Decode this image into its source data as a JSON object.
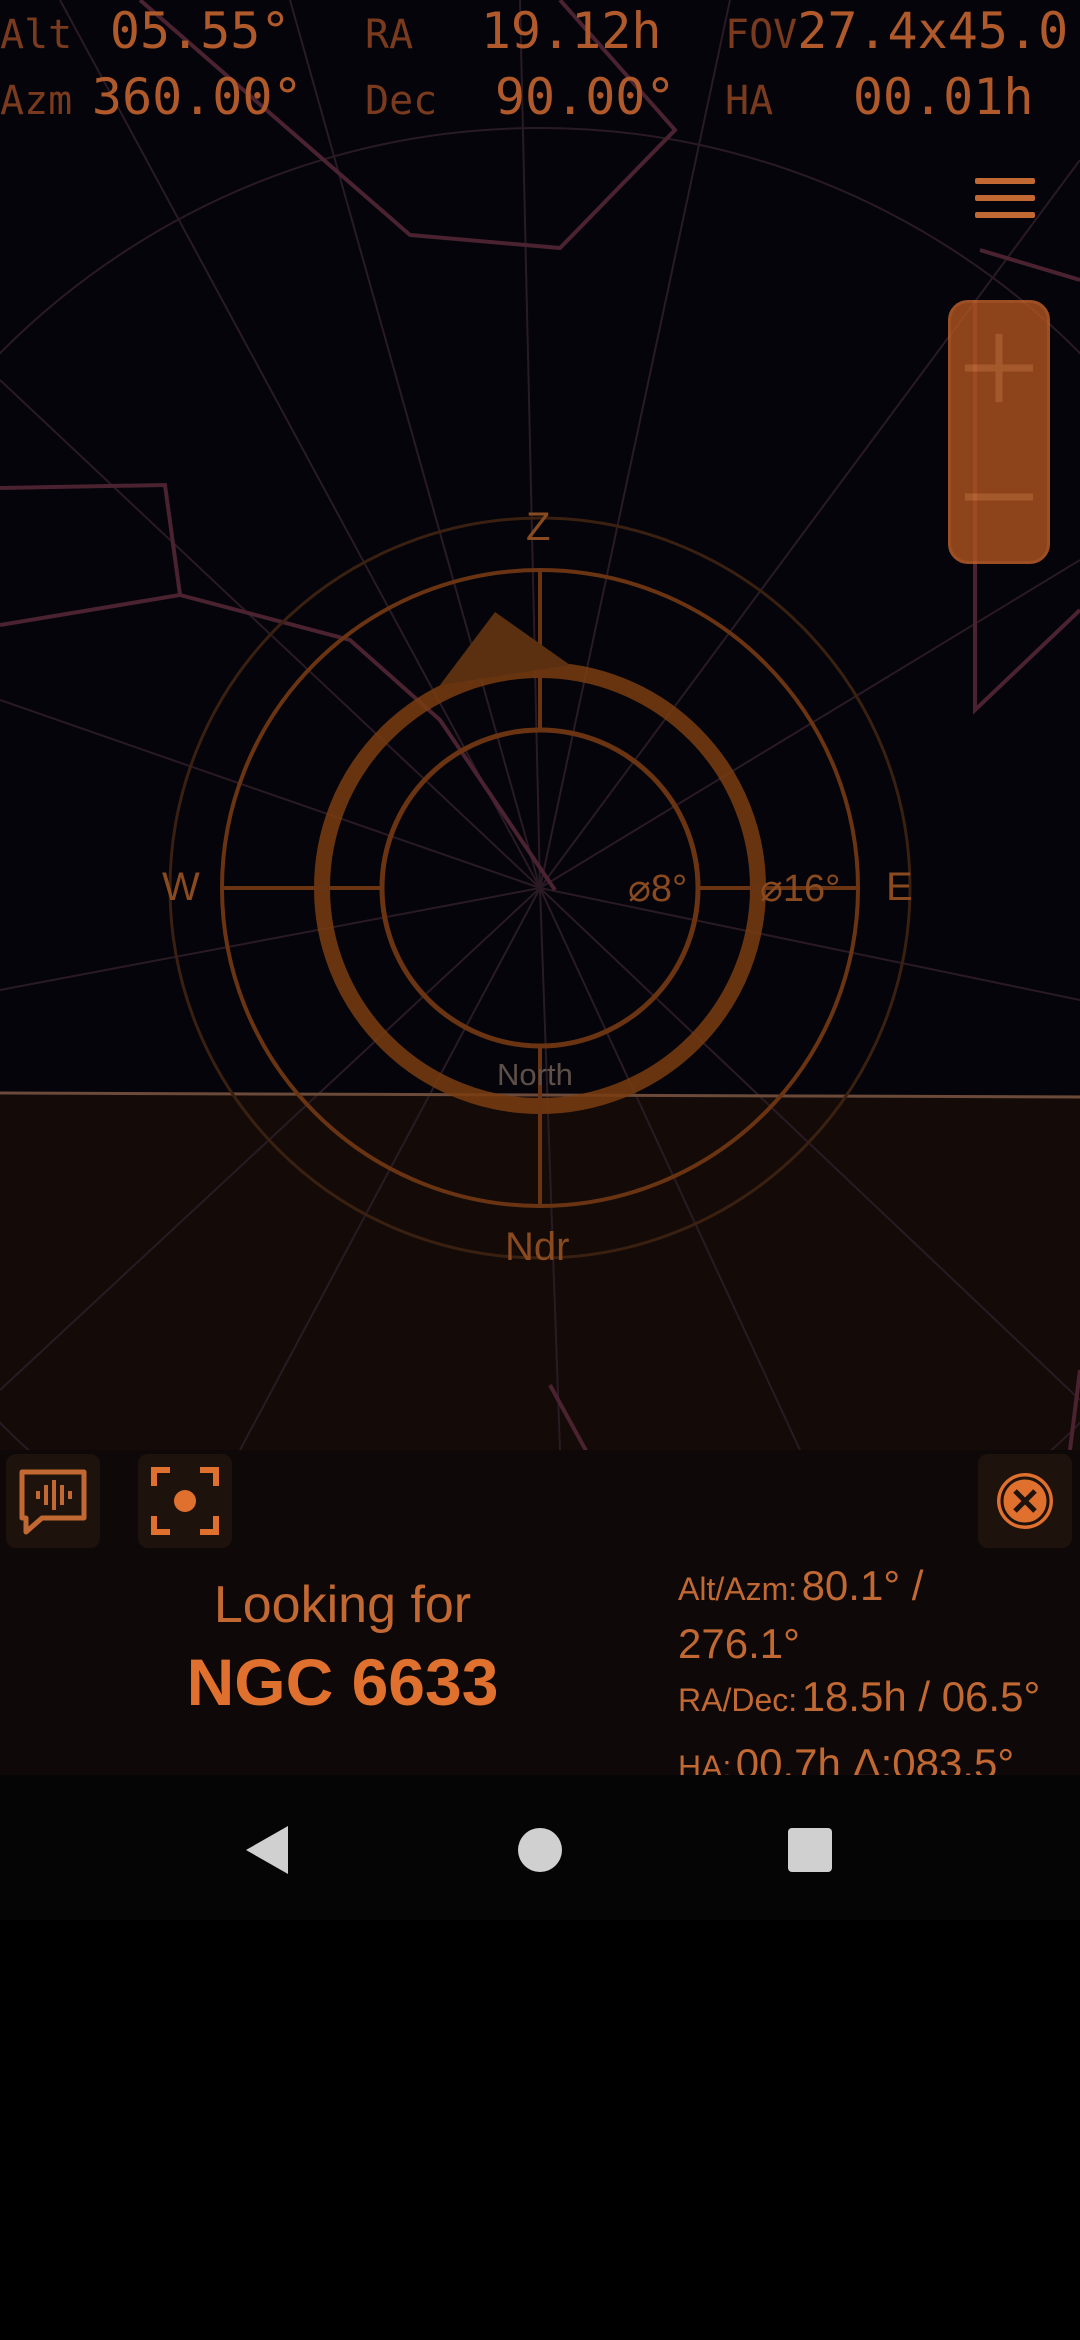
{
  "hud": {
    "alt_label": "Alt",
    "alt_value": "05.55°",
    "ra_label": "RA",
    "ra_value": "19.12h",
    "fov_label": "FOV",
    "fov_value": "27.4x45.0",
    "azm_label": "Azm",
    "azm_value": "360.00°",
    "dec_label": "Dec",
    "dec_value": "90.00°",
    "ha_label": "HA",
    "ha_value": "00.01h"
  },
  "compass": {
    "zenith": "Z",
    "nadir": "Ndr",
    "west": "W",
    "east": "E",
    "ring_inner": "⌀8°",
    "ring_outer": "⌀16°",
    "direction": "North"
  },
  "target": {
    "looking_for": "Looking for",
    "name": "NGC 6633",
    "alt_azm_label": "Alt/Azm:",
    "alt_azm_value": "80.1° /",
    "alt_azm_value2": "276.1°",
    "ra_dec_label": "RA/Dec:",
    "ra_dec_value": "18.5h / 06.5°",
    "ha_label": "HA:",
    "ha_value": "00.7h Δ:083.5°"
  },
  "colors": {
    "accent": "#e0702e",
    "dim": "#8a4a20",
    "sky": "#04040a",
    "ground": "#140b08"
  },
  "icons": {
    "menu": "hamburger-icon",
    "zoom_in": "plus-icon",
    "zoom_out": "minus-icon",
    "voice": "voice-chat-icon",
    "focus": "focus-target-icon",
    "close": "close-icon",
    "back": "back-icon",
    "home": "home-icon",
    "recents": "recents-icon"
  }
}
